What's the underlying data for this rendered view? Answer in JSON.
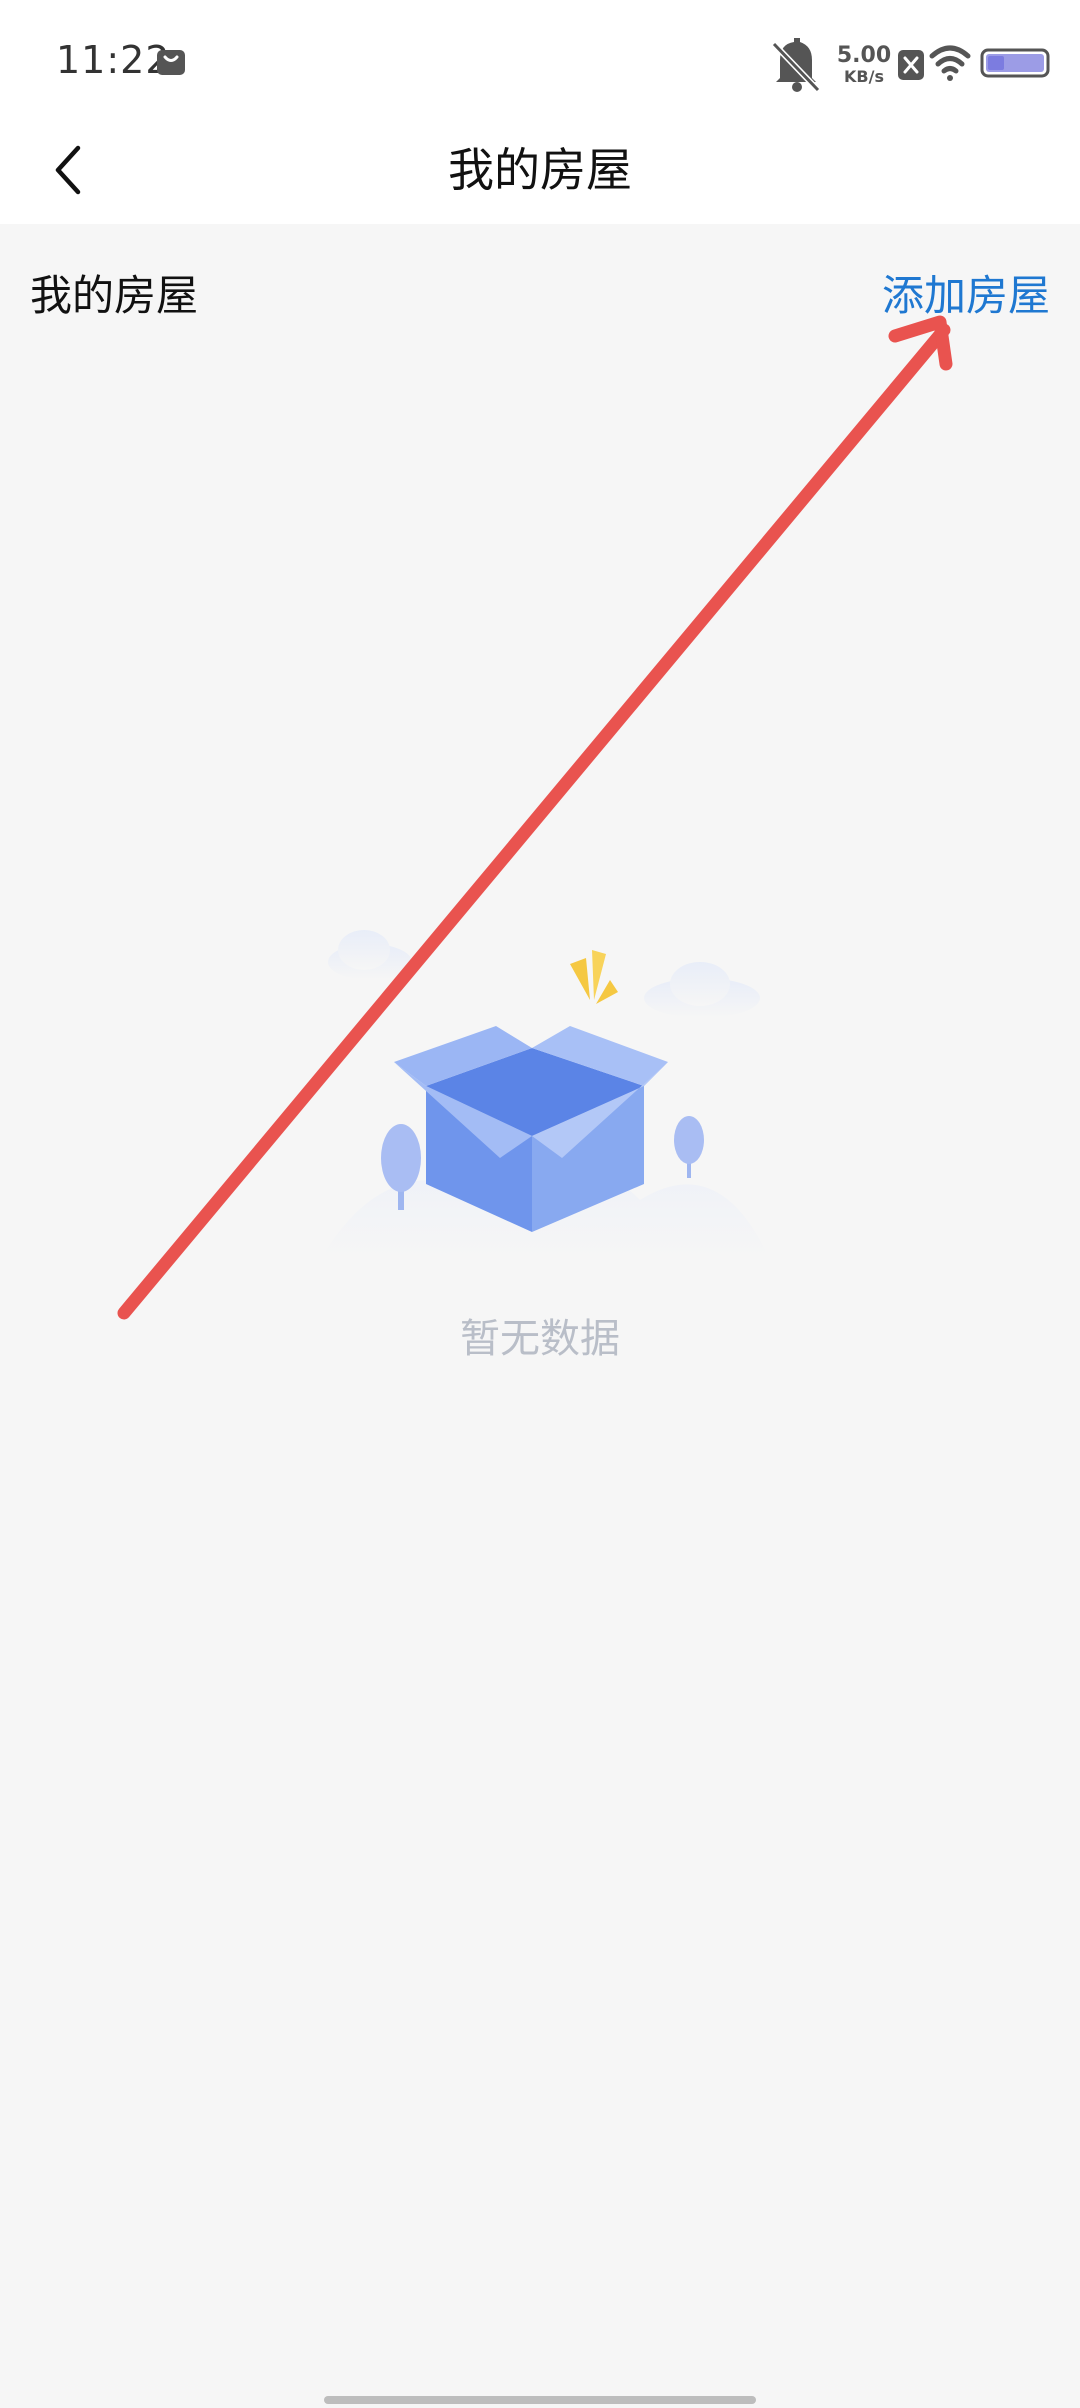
{
  "status_bar": {
    "time": "11:22",
    "app_icon": "shopping-bag-icon",
    "net_speed_value": "5.00",
    "net_speed_unit": "KB/s",
    "icons": [
      "mute-icon",
      "sim-off-icon",
      "wifi-icon",
      "battery-icon"
    ]
  },
  "header": {
    "back_icon": "chevron-left-icon",
    "title": "我的房屋"
  },
  "section": {
    "title": "我的房屋",
    "add_label": "添加房屋"
  },
  "empty_state": {
    "illustration": "empty-box-illustration",
    "text": "暂无数据"
  },
  "colors": {
    "accent": "#1f78d1",
    "background": "#f6f6f6",
    "annotation_arrow": "#e9534f",
    "empty_text": "#b9bec8"
  }
}
